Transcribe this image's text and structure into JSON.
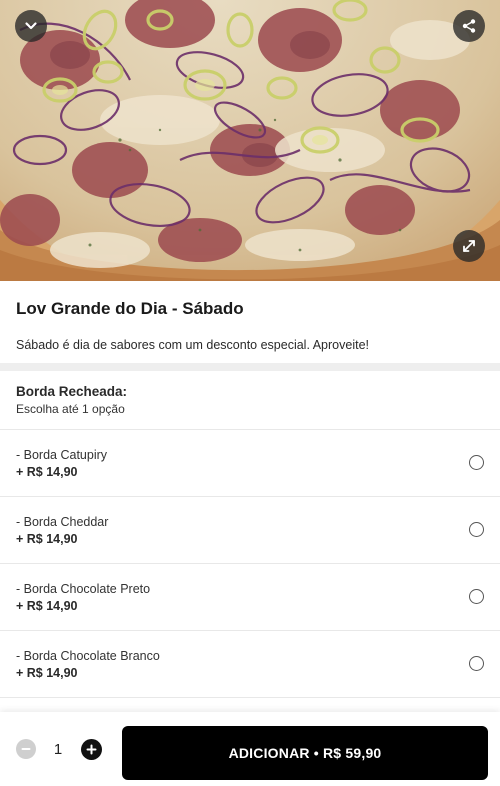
{
  "hero": {
    "image_alt": "Pizza com cebola roxa, alho-poró e queijo",
    "icons": {
      "back": "chevron-down-icon",
      "share": "share-icon",
      "expand": "expand-icon"
    }
  },
  "product": {
    "title": "Lov Grande do Dia - Sábado",
    "description": "Sábado é dia de sabores com um desconto especial. Aproveite!"
  },
  "option_group": {
    "title": "Borda Recheada:",
    "subtitle": "Escolha até 1 opção",
    "options": [
      {
        "name": "- Borda Catupiry",
        "price": "+ R$ 14,90",
        "selected": false
      },
      {
        "name": "- Borda Cheddar",
        "price": "+ R$ 14,90",
        "selected": false
      },
      {
        "name": "- Borda Chocolate Preto",
        "price": "+ R$ 14,90",
        "selected": false
      },
      {
        "name": "- Borda Chocolate Branco",
        "price": "+ R$ 14,90",
        "selected": false
      }
    ]
  },
  "cart": {
    "quantity": "1",
    "add_label": "ADICIONAR",
    "separator": "•",
    "total": "R$ 59,90"
  },
  "colors": {
    "primary_button": "#000000",
    "separator": "#eeeeee"
  }
}
